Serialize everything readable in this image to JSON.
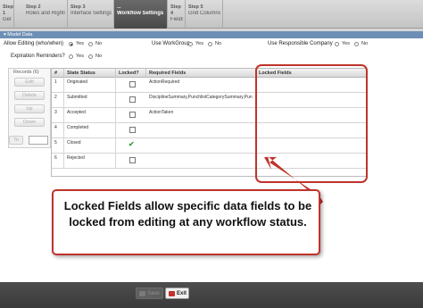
{
  "tabs": [
    {
      "step": "Step 1",
      "label": "General"
    },
    {
      "step": "Step 2",
      "label": "Roles and Rights"
    },
    {
      "step": "Step 3",
      "label": "Interface Settings"
    },
    {
      "step": "...",
      "label": "Workflow Settings"
    },
    {
      "step": "Step 4",
      "label": "Fields"
    },
    {
      "step": "Step 5",
      "label": "Grid Columns"
    }
  ],
  "section": {
    "title": "Model Data"
  },
  "options": {
    "allow_editing": {
      "label": "Allow Editing (who/when)",
      "yes": "Yes",
      "no": "No",
      "selected": "Yes"
    },
    "use_workgroup": {
      "label": "Use WorkGroup",
      "yes": "Yes",
      "no": "No",
      "selected": "none"
    },
    "use_responsible_company": {
      "label": "Use Responsible Company",
      "yes": "Yes",
      "no": "No",
      "selected": "none"
    },
    "expiration_reminders": {
      "label": "Expiration Reminders?",
      "yes": "Yes",
      "no": "No",
      "selected": "none"
    }
  },
  "records": {
    "title": "Records (6)",
    "buttons": {
      "edit": "Edit",
      "delete": "Delete",
      "up": "Up",
      "down": "Down",
      "to": "To"
    }
  },
  "grid": {
    "headers": {
      "num": "#",
      "state_status": "State Status",
      "locked": "Locked?",
      "required_fields": "Required Fields",
      "locked_fields": "Locked Fields"
    },
    "rows": [
      {
        "num": "1",
        "state": "Originated",
        "locked": false,
        "required": "ActionRequired",
        "locked_fields": ""
      },
      {
        "num": "2",
        "state": "Submitted",
        "locked": false,
        "required": "DisciplineSummary,PunchlistCategorySummary,Pun",
        "locked_fields": ""
      },
      {
        "num": "3",
        "state": "Accepted",
        "locked": false,
        "required": "ActionTaken",
        "locked_fields": ""
      },
      {
        "num": "4",
        "state": "Completed",
        "locked": false,
        "required": "",
        "locked_fields": ""
      },
      {
        "num": "5",
        "state": "Closed",
        "locked": true,
        "required": "",
        "locked_fields": ""
      },
      {
        "num": "6",
        "state": "Rejected",
        "locked": false,
        "required": "",
        "locked_fields": ""
      }
    ]
  },
  "callout": {
    "text": "Locked Fields allow specific data fields to be locked from editing at any workflow status."
  },
  "bottom": {
    "save_label": "Save",
    "exit_label": "Exit"
  },
  "colors": {
    "accent": "#c0332b",
    "header_blue": "#6e8fb5",
    "check_green": "#3aa036"
  },
  "icons": {
    "checked": "checkmark-icon",
    "save": "save-icon",
    "exit": "exit-icon"
  }
}
